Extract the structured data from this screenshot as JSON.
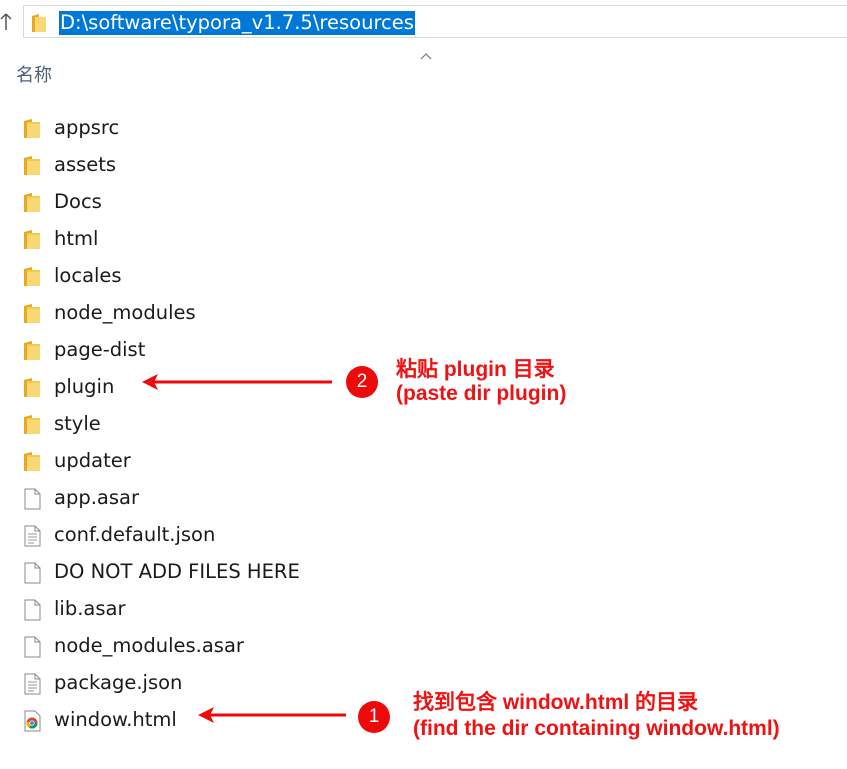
{
  "address_bar": {
    "path": "D:\\software\\typora_v1.7.5\\resources"
  },
  "columns": {
    "name_header": "名称"
  },
  "files": [
    {
      "name": "appsrc",
      "type": "folder",
      "icon": "folder-icon"
    },
    {
      "name": "assets",
      "type": "folder",
      "icon": "folder-icon"
    },
    {
      "name": "Docs",
      "type": "folder",
      "icon": "folder-icon"
    },
    {
      "name": "html",
      "type": "folder",
      "icon": "folder-icon"
    },
    {
      "name": "locales",
      "type": "folder",
      "icon": "folder-icon"
    },
    {
      "name": "node_modules",
      "type": "folder",
      "icon": "folder-icon"
    },
    {
      "name": "page-dist",
      "type": "folder",
      "icon": "folder-icon"
    },
    {
      "name": "plugin",
      "type": "folder",
      "icon": "folder-icon"
    },
    {
      "name": "style",
      "type": "folder",
      "icon": "folder-icon"
    },
    {
      "name": "updater",
      "type": "folder",
      "icon": "folder-icon"
    },
    {
      "name": "app.asar",
      "type": "file",
      "icon": "blank-file-icon"
    },
    {
      "name": "conf.default.json",
      "type": "file",
      "icon": "text-file-icon"
    },
    {
      "name": "DO NOT ADD FILES HERE",
      "type": "file",
      "icon": "blank-file-icon"
    },
    {
      "name": "lib.asar",
      "type": "file",
      "icon": "blank-file-icon"
    },
    {
      "name": "node_modules.asar",
      "type": "file",
      "icon": "blank-file-icon"
    },
    {
      "name": "package.json",
      "type": "file",
      "icon": "text-file-icon"
    },
    {
      "name": "window.html",
      "type": "html",
      "icon": "chrome-html-icon"
    }
  ],
  "annotations": [
    {
      "badge": "2",
      "line1": "粘贴 plugin 目录",
      "line2": "(paste dir plugin)"
    },
    {
      "badge": "1",
      "line1": "找到包含 window.html 的目录",
      "line2": "(find the dir containing window.html)"
    }
  ],
  "colors": {
    "selection": "#0078d7",
    "annotation_red": "#ee0a0a",
    "folder_yellow": "#f8d775"
  }
}
